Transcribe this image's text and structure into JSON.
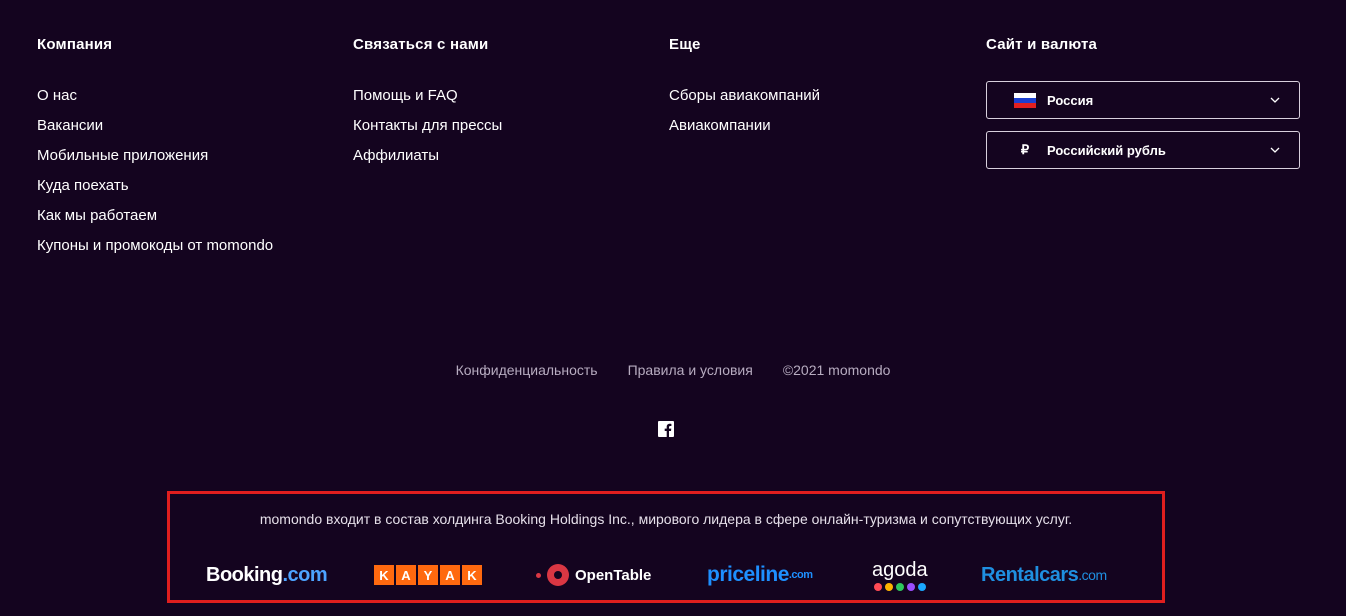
{
  "columns": [
    {
      "title": "Компания",
      "links": [
        "О нас",
        "Вакансии",
        "Мобильные приложения",
        "Куда поехать",
        "Как мы работаем",
        "Купоны и промокоды от momondo"
      ]
    },
    {
      "title": "Связаться с нами",
      "links": [
        "Помощь и FAQ",
        "Контакты для прессы",
        "Аффилиаты"
      ]
    },
    {
      "title": "Еще",
      "links": [
        "Сборы авиакомпаний",
        "Авиакомпании"
      ]
    }
  ],
  "site_currency": {
    "title": "Сайт и валюта",
    "country": "Россия",
    "country_icon": "russia-flag-icon",
    "currency_symbol": "₽",
    "currency": "Российский рубль"
  },
  "legal": {
    "privacy": "Конфиденциальность",
    "terms": "Правила и условия",
    "copyright": "©2021 momondo"
  },
  "social": {
    "facebook_icon": "facebook-icon"
  },
  "holding": {
    "note": "momondo входит в состав холдинга Booking Holdings Inc., мирового лидера в сфере онлайн-туризма и сопутствующих услуг.",
    "brands": {
      "booking_main": "Booking",
      "booking_dot": ".com",
      "kayak_letters": [
        "K",
        "A",
        "Y",
        "A",
        "K"
      ],
      "opentable": "OpenTable",
      "opentable_mark": "·",
      "priceline_main": "priceline",
      "priceline_dot": ".com",
      "agoda": "agoda",
      "agoda_dot_colors": [
        "#ff4b55",
        "#ffb400",
        "#2ec85e",
        "#9b4dff",
        "#1aa8ff"
      ],
      "rentalcars_main": "Rentalcars",
      "rentalcars_dot": ".com"
    }
  },
  "colors": {
    "background": "#14041f",
    "highlight_border": "#e01e1e"
  }
}
